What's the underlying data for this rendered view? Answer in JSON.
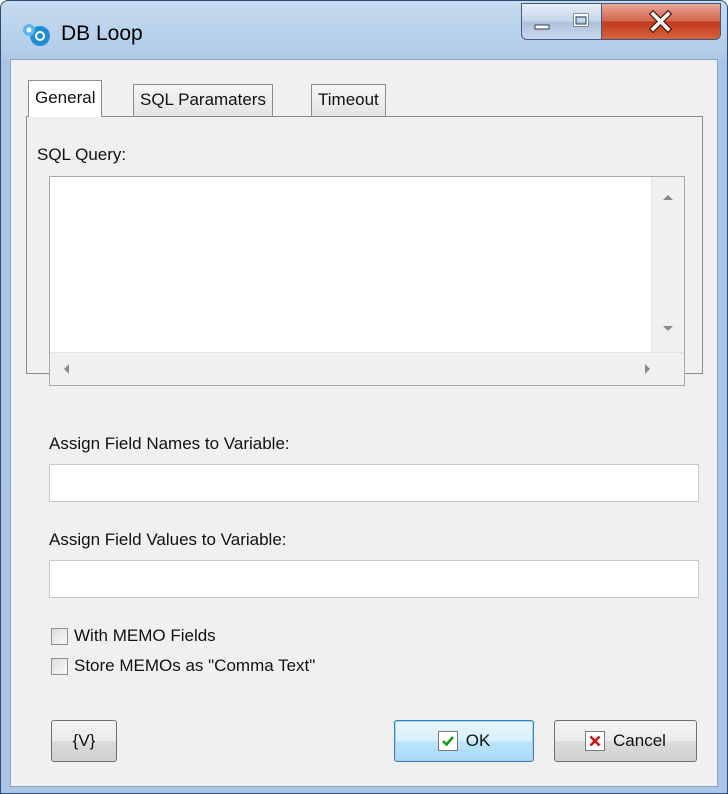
{
  "window": {
    "title": "DB Loop",
    "minimize_glyph": "▁",
    "maximize_glyph": "□",
    "close_glyph": "X"
  },
  "tabs": [
    {
      "label": "General",
      "active": true
    },
    {
      "label": "SQL Paramaters",
      "active": false
    },
    {
      "label": "Timeout",
      "active": false
    }
  ],
  "general": {
    "sql_query_label": "SQL Query:",
    "sql_query_value": "",
    "field_names_label": "Assign Field Names to Variable:",
    "field_names_value": "",
    "field_values_label": "Assign Field Values to Variable:",
    "field_values_value": "",
    "with_memo_label": "With MEMO Fields",
    "with_memo_checked": false,
    "store_memo_label": "Store MEMOs as \"Comma Text\"",
    "store_memo_checked": false
  },
  "buttons": {
    "variables_label": "{V}",
    "ok_label": "OK",
    "cancel_label": "Cancel"
  },
  "icons": {
    "app": "db-loop-app-icon",
    "ok": "green-check-icon",
    "cancel": "red-x-icon"
  },
  "colors": {
    "ok_check": "#1a9a1a",
    "cancel_x": "#d01616",
    "close_button": "#c8452a"
  }
}
